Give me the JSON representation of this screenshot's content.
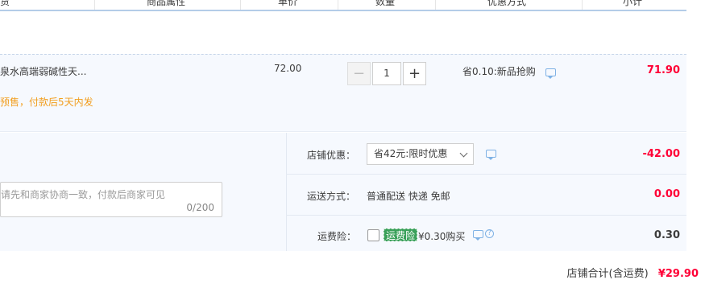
{
  "header": {
    "col_goods": "货",
    "col_attrs": "商品属性",
    "col_price": "单价",
    "col_qty": "数量",
    "col_discount": "优惠方式",
    "col_subtotal": "小计"
  },
  "item": {
    "title": "泉水高端弱碱性天...",
    "note": "预售，付款后5天内发",
    "unit_price": "72.00",
    "quantity": "1",
    "minus_label": "−",
    "plus_label": "+",
    "promo_text": "省0.10:新品抢购",
    "subtotal": "71.90"
  },
  "shop": {
    "discount_label": "店铺优惠：",
    "discount_select": "省42元:限时优惠",
    "discount_value": "-42.00",
    "shipping_label": "运送方式：",
    "shipping_text": "普通配送 快递 免邮",
    "shipping_value": "0.00",
    "insurance_label": "运费险：",
    "insurance_tag": "运费险",
    "insurance_text": "¥0.30购买",
    "insurance_value": "0.30",
    "total_label": "店铺合计(含运费)",
    "total_value": "¥29.90"
  },
  "message": {
    "placeholder": "请先和商家协商一致，付款后商家可见",
    "counter": "0/200"
  },
  "colors": {
    "price_red": "#ff0036",
    "note_orange": "#f29e1f",
    "insurance_green": "#3aa05a",
    "row_bg": "#f6f9fe"
  }
}
